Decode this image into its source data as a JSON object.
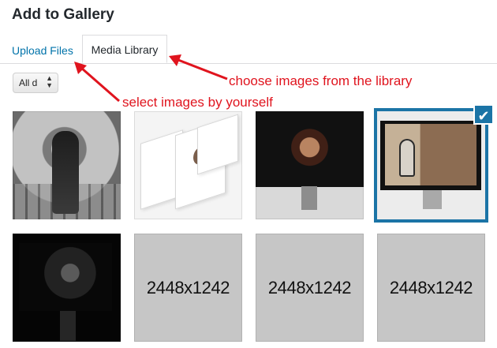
{
  "header": {
    "title": "Add to Gallery"
  },
  "tabs": [
    {
      "label": "Upload Files"
    },
    {
      "label": "Media Library"
    }
  ],
  "filter": {
    "label": "All d"
  },
  "annotations": {
    "library": "choose images from the library",
    "self": "select images by yourself"
  },
  "gallery": {
    "items": [
      {
        "type": "photo",
        "description": "woman-on-rails"
      },
      {
        "type": "photo",
        "description": "website-mockups"
      },
      {
        "type": "photo",
        "description": "imac-portrait"
      },
      {
        "type": "photo",
        "description": "imac-woman-hat",
        "selected": true
      },
      {
        "type": "photo",
        "description": "dark-imac"
      },
      {
        "type": "placeholder",
        "label": "2448x1242"
      },
      {
        "type": "placeholder",
        "label": "2448x1242"
      },
      {
        "type": "placeholder",
        "label": "2448x1242"
      }
    ]
  },
  "colors": {
    "accent": "#1b74a6",
    "link": "#0073aa",
    "annotation": "#e0141e"
  }
}
